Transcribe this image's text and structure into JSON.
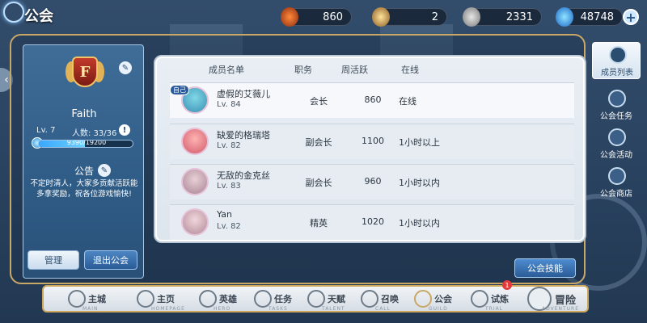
{
  "header": {
    "title": "公会",
    "resources": [
      {
        "icon": "fire-crystal-icon",
        "value": "860"
      },
      {
        "icon": "gold-coin-icon",
        "value": "2"
      },
      {
        "icon": "silver-coin-icon",
        "value": "2331"
      },
      {
        "icon": "blue-gem-icon",
        "value": "48748"
      }
    ],
    "plus": "+"
  },
  "guild": {
    "emblem_letter": "F",
    "name": "Faith",
    "level": "Lv. 7",
    "members": "人数: 33/36",
    "xp_text": "9390/19200",
    "xp_fraction": 0.489,
    "notice_title": "公告",
    "notice_text": "不定时清人，大家多贡献活跃能多拿奖励，祝各位游戏愉快!",
    "manage_label": "管理",
    "quit_label": "退出公会"
  },
  "member_list": {
    "headers": {
      "name": "成员名单",
      "role": "职务",
      "weekly": "周活跃",
      "online": "在线"
    },
    "self_tag": "自己",
    "rows": [
      {
        "name": "虚假的艾薇儿",
        "level": "Lv. 84",
        "role": "会长",
        "weekly": "860",
        "online": "在线"
      },
      {
        "name": "缺爱的格瑞塔",
        "level": "Lv. 82",
        "role": "副会长",
        "weekly": "1100",
        "online": "1小时以上"
      },
      {
        "name": "无敌的金克丝",
        "level": "Lv. 83",
        "role": "副会长",
        "weekly": "960",
        "online": "1小时以内"
      },
      {
        "name": "Yan",
        "level": "Lv. 82",
        "role": "精英",
        "weekly": "1020",
        "online": "1小时以内"
      }
    ]
  },
  "skill_button": "公会技能",
  "side_tabs": [
    "成员列表",
    "公会任务",
    "公会活动",
    "公会商店"
  ],
  "bottom_nav": [
    {
      "label": "主城",
      "sub": "MAIN"
    },
    {
      "label": "主页",
      "sub": "HOMEPAGE"
    },
    {
      "label": "英雄",
      "sub": "HERO"
    },
    {
      "label": "任务",
      "sub": "TASKS"
    },
    {
      "label": "天赋",
      "sub": "TALENT"
    },
    {
      "label": "召唤",
      "sub": "CALL"
    },
    {
      "label": "公会",
      "sub": "GUILD"
    },
    {
      "label": "试炼",
      "sub": "TRIAL",
      "badge": "1"
    },
    {
      "label": "冒险",
      "sub": "ADVENTURE"
    }
  ]
}
